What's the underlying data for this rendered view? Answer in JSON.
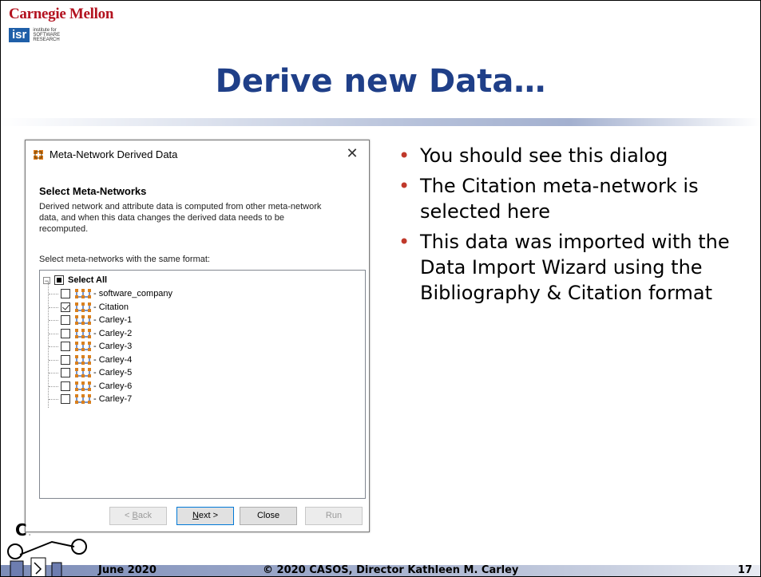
{
  "header": {
    "org_name": "Carnegie Mellon",
    "isr_badge": "isr",
    "isr_line1": "institute for",
    "isr_line2": "SOFTWARE",
    "isr_line3": "RESEARCH"
  },
  "slide": {
    "title": "Derive new Data…",
    "bullets": [
      "You should see this dialog",
      "The Citation meta-network is selected here",
      "This data was imported with the Data Import Wizard using the Bibliography & Citation format"
    ]
  },
  "dialog": {
    "title": "Meta-Network Derived Data",
    "close_glyph": "✕",
    "heading": "Select Meta-Networks",
    "description": "Derived network and attribute data is computed from other meta-network data, and when this data changes the derived data needs to be recomputed.",
    "instruction": "Select meta-networks with the same format:",
    "tree": {
      "root_label": "Select All",
      "root_state": "partial",
      "items": [
        {
          "label": "- software_company",
          "checked": false
        },
        {
          "label": "- Citation",
          "checked": true
        },
        {
          "label": "- Carley-1",
          "checked": false
        },
        {
          "label": "- Carley-2",
          "checked": false
        },
        {
          "label": "- Carley-3",
          "checked": false
        },
        {
          "label": "- Carley-4",
          "checked": false
        },
        {
          "label": "- Carley-5",
          "checked": false
        },
        {
          "label": "- Carley-6",
          "checked": false
        },
        {
          "label": "- Carley-7",
          "checked": false
        }
      ]
    },
    "buttons": {
      "back": "< Back",
      "next": "Next >",
      "close": "Close",
      "run": "Run"
    }
  },
  "footer": {
    "date": "June 2020",
    "copyright": "© 2020 CASOS, Director Kathleen M. Carley",
    "page": "17"
  },
  "colors": {
    "title": "#1f3f88",
    "cmu_red": "#b3121f",
    "bullet": "#c0392b",
    "isr_blue": "#1f5fa8"
  }
}
